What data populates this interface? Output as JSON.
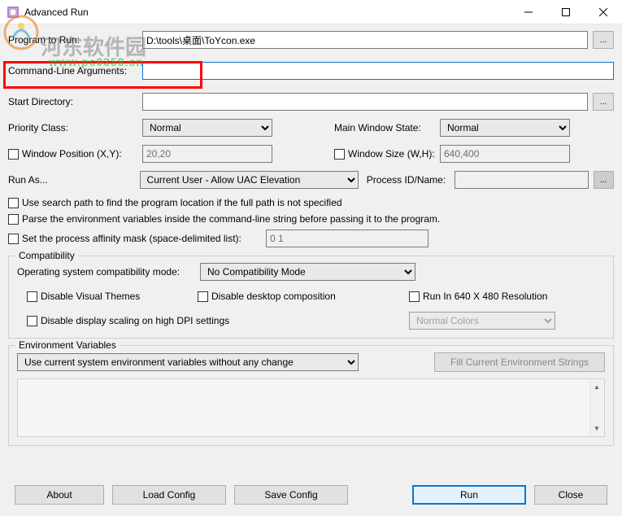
{
  "titlebar": {
    "title": "Advanced Run"
  },
  "watermark": {
    "text": "河东软件园",
    "url": "www.pc0359.cn"
  },
  "fields": {
    "program_label": "Program to Run:",
    "program_value": "D:\\tools\\桌面\\ToYcon.exe",
    "cmdline_label": "Command-Line Arguments:",
    "cmdline_value": "",
    "startdir_label": "Start Directory:",
    "startdir_value": "",
    "priority_label": "Priority Class:",
    "priority_value": "Normal",
    "mainwin_label": "Main Window State:",
    "mainwin_value": "Normal",
    "winpos_label": "Window Position (X,Y):",
    "winpos_value": "20,20",
    "winsize_label": "Window Size (W,H):",
    "winsize_value": "640,400",
    "runas_label": "Run As...",
    "runas_value": "Current User - Allow UAC Elevation",
    "procid_label": "Process ID/Name:",
    "procid_value": "",
    "searchpath_label": "Use search path to find the program location if the full path is not specified",
    "parseenv_label": "Parse the environment variables inside the command-line string before passing it to the program.",
    "affinity_label": "Set the process affinity mask (space-delimited list):",
    "affinity_value": "0 1"
  },
  "compat": {
    "legend": "Compatibility",
    "osmode_label": "Operating system compatibility mode:",
    "osmode_value": "No Compatibility Mode",
    "disable_themes": "Disable Visual Themes",
    "disable_desktop": "Disable desktop composition",
    "run640": "Run In 640 X 480 Resolution",
    "disable_dpi": "Disable display scaling on high DPI settings",
    "colors_value": "Normal Colors"
  },
  "env": {
    "legend": "Environment Variables",
    "mode_value": "Use current system environment variables without any change",
    "fill_btn": "Fill Current Environment Strings"
  },
  "buttons": {
    "about": "About",
    "load": "Load Config",
    "save": "Save Config",
    "run": "Run",
    "close": "Close"
  },
  "browse_label": "..."
}
